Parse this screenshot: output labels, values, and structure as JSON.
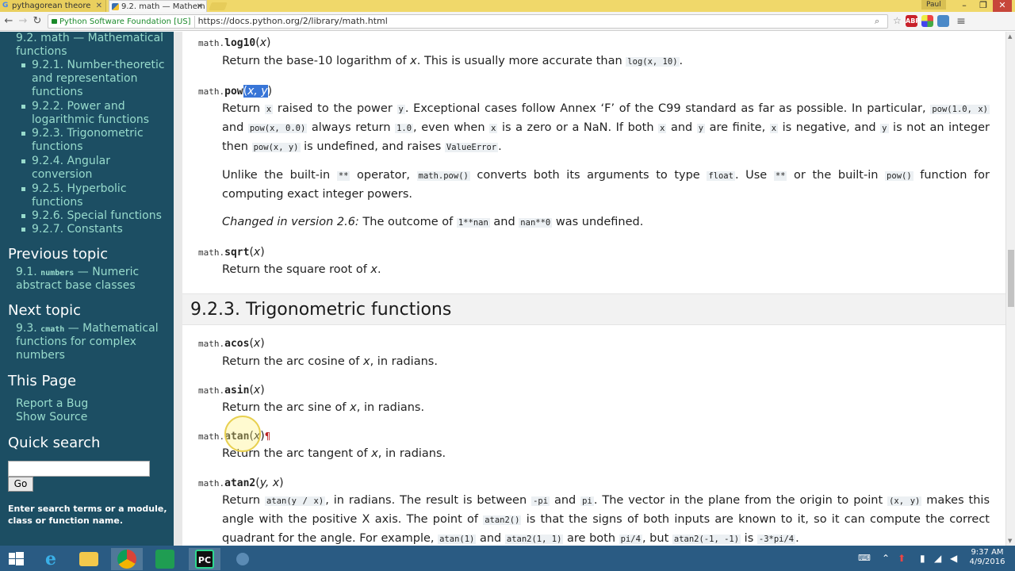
{
  "browser": {
    "tabs": [
      {
        "title": "pythagorean theore"
      },
      {
        "title": "9.2. math — Mathem"
      }
    ],
    "profile_name": "Paul",
    "ev_badge": "Python Software Foundation [US]",
    "url": "https://docs.python.org/2/library/math.html",
    "window_controls": {
      "minimize": "–",
      "maximize": "❐",
      "close": "✕"
    },
    "extensions": [
      {
        "name": "adblock",
        "label": "ABP",
        "color": "#c8202a"
      },
      {
        "name": "color-ext",
        "label": "",
        "color": "#3a8f3a"
      },
      {
        "name": "wave-ext",
        "label": "",
        "color": "#4a89c8"
      }
    ]
  },
  "sidebar": {
    "toc": [
      {
        "lines": [
          "9.2. math — Mathematical",
          "functions"
        ],
        "level": 0
      },
      {
        "lines": [
          "9.2.1. Number-theoretic",
          "and representation",
          "functions"
        ],
        "level": 1
      },
      {
        "lines": [
          "9.2.2. Power and",
          "logarithmic functions"
        ],
        "level": 1
      },
      {
        "lines": [
          "9.2.3. Trigonometric",
          "functions"
        ],
        "level": 1
      },
      {
        "lines": [
          "9.2.4. Angular",
          "conversion"
        ],
        "level": 1
      },
      {
        "lines": [
          "9.2.5. Hyperbolic",
          "functions"
        ],
        "level": 1
      },
      {
        "lines": [
          "9.2.6. Special functions"
        ],
        "level": 1
      },
      {
        "lines": [
          "9.2.7. Constants"
        ],
        "level": 1
      }
    ],
    "previous_heading": "Previous topic",
    "previous_prefix": "9.1. ",
    "previous_code": "numbers",
    "previous_suffix": " — Numeric",
    "previous_line2": "abstract base classes",
    "next_heading": "Next topic",
    "next_prefix": "9.3. ",
    "next_code": "cmath",
    "next_suffix": " — Mathematical",
    "next_line2": "functions for complex",
    "next_line3": "numbers",
    "this_page_heading": "This Page",
    "report_bug": "Report a Bug",
    "show_source": "Show Source",
    "search_heading": "Quick search",
    "search_value": "",
    "go_label": "Go",
    "search_help_1": "Enter search terms or a module,",
    "search_help_2": "class or function name."
  },
  "content": {
    "log10": {
      "mod": "math.",
      "fn": "log10",
      "args": "x",
      "desc_a": "Return the base-10 logarithm of ",
      "desc_x": "x",
      "desc_b": ". This is usually more accurate than ",
      "code": "log(x, 10)",
      "desc_c": "."
    },
    "pow": {
      "mod": "math.",
      "fn": "pow",
      "open": "(",
      "args": "x, y",
      "close": ")",
      "p1": {
        "t1": "Return ",
        "c1": "x",
        "t2": " raised to the power ",
        "c2": "y",
        "t3": ". Exceptional cases follow Annex ‘F’ of the C99 standard as far as possible. In particular, ",
        "c3": "pow(1.0, x)",
        "t4": " and ",
        "c4": "pow(x, 0.0)",
        "t5": " always return ",
        "c5": "1.0",
        "t6": ", even when ",
        "c6": "x",
        "t7": " is a zero or a NaN. If both ",
        "c7": "x",
        "t8": " and ",
        "c8": "y",
        "t9": " are finite, ",
        "c9": "x",
        "t10": " is negative, and ",
        "c10": "y",
        "t11": " is not an integer then ",
        "c11": "pow(x, y)",
        "t12": " is undefined, and raises ",
        "c12": "ValueError",
        "t13": "."
      },
      "p2": {
        "t1": "Unlike the built-in ",
        "c1": "**",
        "t2": " operator, ",
        "c2": "math.pow()",
        "t3": " converts both its arguments to type ",
        "c3": "float",
        "t4": ". Use ",
        "c4": "**",
        "t5": " or the built-in ",
        "c5": "pow()",
        "t6": " function for computing exact integer powers."
      },
      "p3": {
        "em": "Changed in version 2.6:",
        "t1": " The outcome of ",
        "c1": "1**nan",
        "t2": " and ",
        "c2": "nan**0",
        "t3": " was undefined."
      }
    },
    "sqrt": {
      "mod": "math.",
      "fn": "sqrt",
      "args": "x",
      "desc_a": "Return the square root of ",
      "desc_x": "x",
      "desc_b": "."
    },
    "section_title": "9.2.3. Trigonometric functions",
    "acos": {
      "mod": "math.",
      "fn": "acos",
      "args": "x",
      "desc_a": "Return the arc cosine of ",
      "desc_x": "x",
      "desc_b": ", in radians."
    },
    "asin": {
      "mod": "math.",
      "fn": "asin",
      "args": "x",
      "desc_a": "Return the arc sine of ",
      "desc_x": "x",
      "desc_b": ", in radians."
    },
    "atan": {
      "mod": "math.",
      "fn": "atan",
      "args": "x",
      "pilcrow": "¶",
      "desc_a": "Return the arc tangent of ",
      "desc_x": "x",
      "desc_b": ", in radians."
    },
    "atan2": {
      "mod": "math.",
      "fn": "atan2",
      "args": "y, x",
      "t1": "Return ",
      "c1": "atan(y / x)",
      "t2": ", in radians. The result is between ",
      "c2": "-pi",
      "t3": " and ",
      "c3": "pi",
      "t4": ". The vector in the plane from the origin to point ",
      "c4": "(x, y)",
      "t5": " makes this angle with the positive X axis. The point of ",
      "c5": "atan2()",
      "t6": " is that the signs of both inputs are known to it, so it can compute the correct quadrant for the angle. For example, ",
      "c6": "atan(1)",
      "t7": " and ",
      "c7": "atan2(1, 1)",
      "t8": " are both ",
      "c8": "pi/4",
      "t9": ", but ",
      "c9": "atan2(-1, -1)",
      "t10": " is ",
      "c10": "-3*pi/4",
      "t11": "."
    }
  },
  "taskbar": {
    "apps": [
      {
        "name": "start-button",
        "label": ""
      },
      {
        "name": "internet-explorer",
        "label": "e"
      },
      {
        "name": "file-explorer",
        "label": ""
      },
      {
        "name": "chrome",
        "label": ""
      },
      {
        "name": "store",
        "label": ""
      },
      {
        "name": "pycharm",
        "label": "PC"
      },
      {
        "name": "other-app",
        "label": ""
      }
    ],
    "time": "9:37 AM",
    "date": "4/9/2016"
  }
}
